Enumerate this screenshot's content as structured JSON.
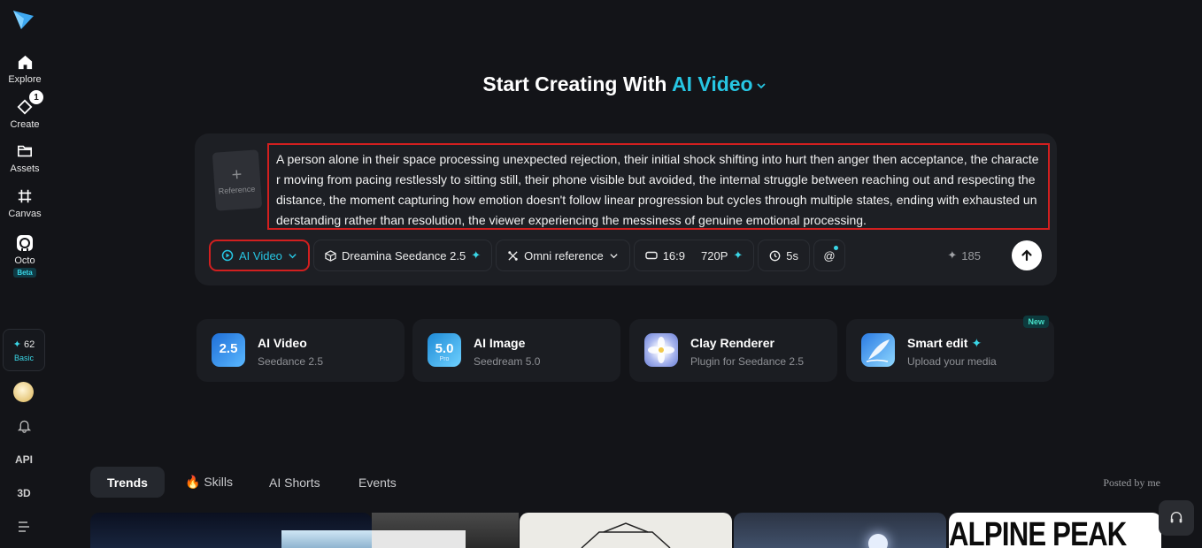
{
  "sidebar": {
    "items": [
      {
        "label": "Explore",
        "icon": "home-icon"
      },
      {
        "label": "Create",
        "icon": "create-icon",
        "badge": "1"
      },
      {
        "label": "Assets",
        "icon": "folder-icon"
      },
      {
        "label": "Canvas",
        "icon": "canvas-icon"
      },
      {
        "label": "Octo",
        "icon": "octo-icon",
        "tag": "Beta"
      }
    ],
    "credits": {
      "value": "62",
      "tier": "Basic"
    },
    "bottom": {
      "api": "API",
      "three_d": "3D"
    }
  },
  "hero": {
    "title_prefix": "Start Creating With ",
    "title_accent": "AI Video"
  },
  "prompt": {
    "reference_label": "Reference",
    "text": "A person alone in their space processing unexpected rejection, their initial shock shifting into hurt then anger then acceptance, the character moving from pacing restlessly to sitting still, their phone visible but avoided, the internal struggle between reaching out and respecting the distance, the moment capturing how emotion doesn't follow linear progression but cycles through multiple states, ending with exhausted understanding rather than resolution, the viewer experiencing the messiness of genuine emotional processing."
  },
  "toolbar": {
    "mode": "AI Video",
    "model": "Dreamina Seedance 2.5",
    "reference": "Omni reference",
    "ratio": "16:9",
    "resolution": "720P",
    "duration": "5s",
    "mention": "@",
    "cost": "185"
  },
  "features": [
    {
      "name": "AI Video",
      "sub": "Seedance 2.5",
      "thumb_text": "2.5",
      "thumb_sub": ""
    },
    {
      "name": "AI Image",
      "sub": "Seedream 5.0",
      "thumb_text": "5.0",
      "thumb_sub": "Pro"
    },
    {
      "name": "Clay Renderer",
      "sub": "Plugin for Seedance 2.5"
    },
    {
      "name": "Smart edit",
      "sub": "Upload your media",
      "badge": "New"
    }
  ],
  "tabs": [
    {
      "label": "Trends",
      "active": true
    },
    {
      "label": "🔥 Skills"
    },
    {
      "label": "AI Shorts"
    },
    {
      "label": "Events"
    }
  ],
  "posted_by": "Posted by me",
  "gallery": {
    "alpine_text": "ALPINE PEAK"
  },
  "colors": {
    "accent": "#27c6e3",
    "highlight_border": "#d21f1f",
    "background": "#131418",
    "card": "#1d1f24"
  }
}
